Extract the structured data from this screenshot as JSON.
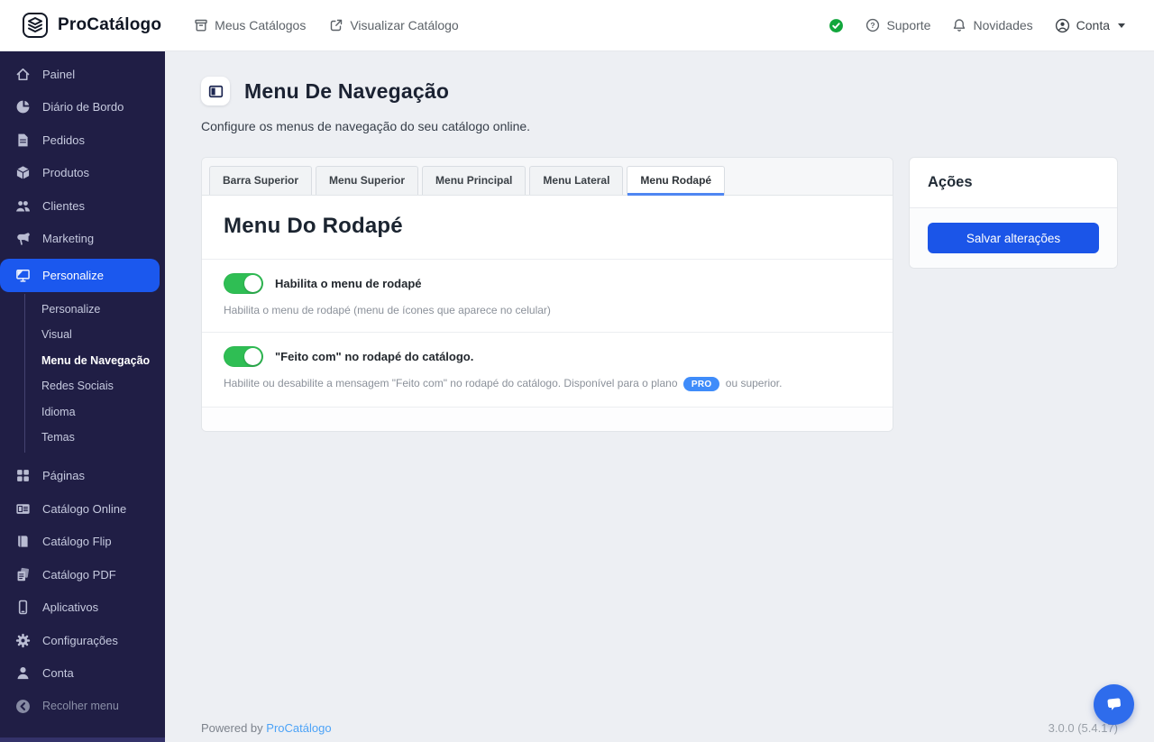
{
  "header": {
    "brand": "ProCatálogo",
    "nav": [
      {
        "label": "Meus Catálogos"
      },
      {
        "label": "Visualizar Catálogo"
      }
    ],
    "right": [
      {
        "label": "Suporte"
      },
      {
        "label": "Novidades"
      },
      {
        "label": "Conta"
      }
    ]
  },
  "sidebar": {
    "items": [
      {
        "label": "Painel"
      },
      {
        "label": "Diário de Bordo"
      },
      {
        "label": "Pedidos"
      },
      {
        "label": "Produtos"
      },
      {
        "label": "Clientes"
      },
      {
        "label": "Marketing"
      },
      {
        "label": "Personalize"
      },
      {
        "label": "Páginas"
      },
      {
        "label": "Catálogo Online"
      },
      {
        "label": "Catálogo Flip"
      },
      {
        "label": "Catálogo PDF"
      },
      {
        "label": "Aplicativos"
      },
      {
        "label": "Configurações"
      },
      {
        "label": "Conta"
      }
    ],
    "personalize_children": [
      "Personalize",
      "Visual",
      "Menu de Navegação",
      "Redes Sociais",
      "Idioma",
      "Temas"
    ],
    "active_item": "Personalize",
    "active_child": "Menu de Navegação",
    "collapse_label": "Recolher menu"
  },
  "page": {
    "title": "Menu De Navegação",
    "subtitle": "Configure os menus de navegação do seu catálogo online."
  },
  "tabs": {
    "items": [
      "Barra Superior",
      "Menu Superior",
      "Menu Principal",
      "Menu Lateral",
      "Menu Rodapé"
    ],
    "active": "Menu Rodapé"
  },
  "card": {
    "section_title": "Menu Do Rodapé",
    "settings": [
      {
        "label": "Habilita o menu de rodapé",
        "help": "Habilita o menu de rodapé (menu de ícones que aparece no celular)",
        "enabled": true
      },
      {
        "label": "\"Feito com\" no rodapé do catálogo.",
        "help_prefix": "Habilite ou desabilite a mensagem \"Feito com\" no rodapé do catálogo. Disponível para o plano",
        "badge": "PRO",
        "help_suffix": "ou superior.",
        "enabled": true
      }
    ]
  },
  "actions": {
    "title": "Ações",
    "save_label": "Salvar alterações"
  },
  "footer": {
    "powered_prefix": "Powered by",
    "brand_link": "ProCatálogo",
    "version": "3.0.0 (5.4.17)"
  },
  "colors": {
    "accent_blue": "#1b55e8",
    "sidebar_bg": "#201e45",
    "toggle_green": "#2fbe54",
    "badge_blue": "#3f8cfa",
    "status_green": "#11a63c",
    "tab_underline": "#4f86f2"
  }
}
